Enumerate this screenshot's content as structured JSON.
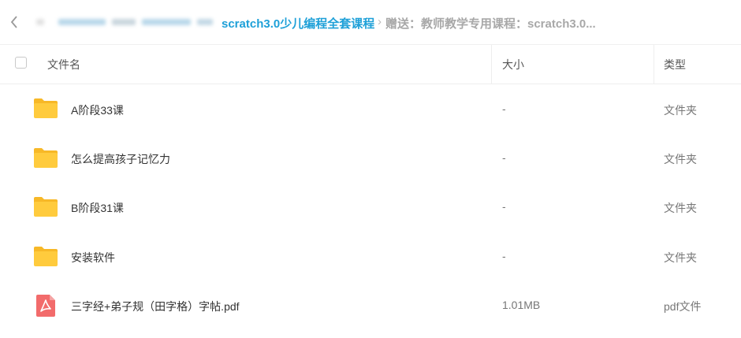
{
  "breadcrumb": {
    "back_icon": "chevron-left-icon",
    "active": "scratch3.0少儿编程全套课程",
    "separator": "›",
    "current": "赠送：教师教学专用课程：scratch3.0..."
  },
  "columns": {
    "name": "文件名",
    "size": "大小",
    "type": "类型"
  },
  "files": [
    {
      "icon": "folder-icon",
      "name": "A阶段33课",
      "size": "-",
      "type": "文件夹"
    },
    {
      "icon": "folder-icon",
      "name": "怎么提高孩子记忆力",
      "size": "-",
      "type": "文件夹"
    },
    {
      "icon": "folder-icon",
      "name": "B阶段31课",
      "size": "-",
      "type": "文件夹"
    },
    {
      "icon": "folder-icon",
      "name": "安装软件",
      "size": "-",
      "type": "文件夹"
    },
    {
      "icon": "pdf-icon",
      "name": "三字经+弟子规（田字格）字帖.pdf",
      "size": "1.01MB",
      "type": "pdf文件"
    }
  ],
  "colors": {
    "accent": "#1ea0d8",
    "folder": "#ffc93b",
    "pdf": "#f26b6b"
  }
}
